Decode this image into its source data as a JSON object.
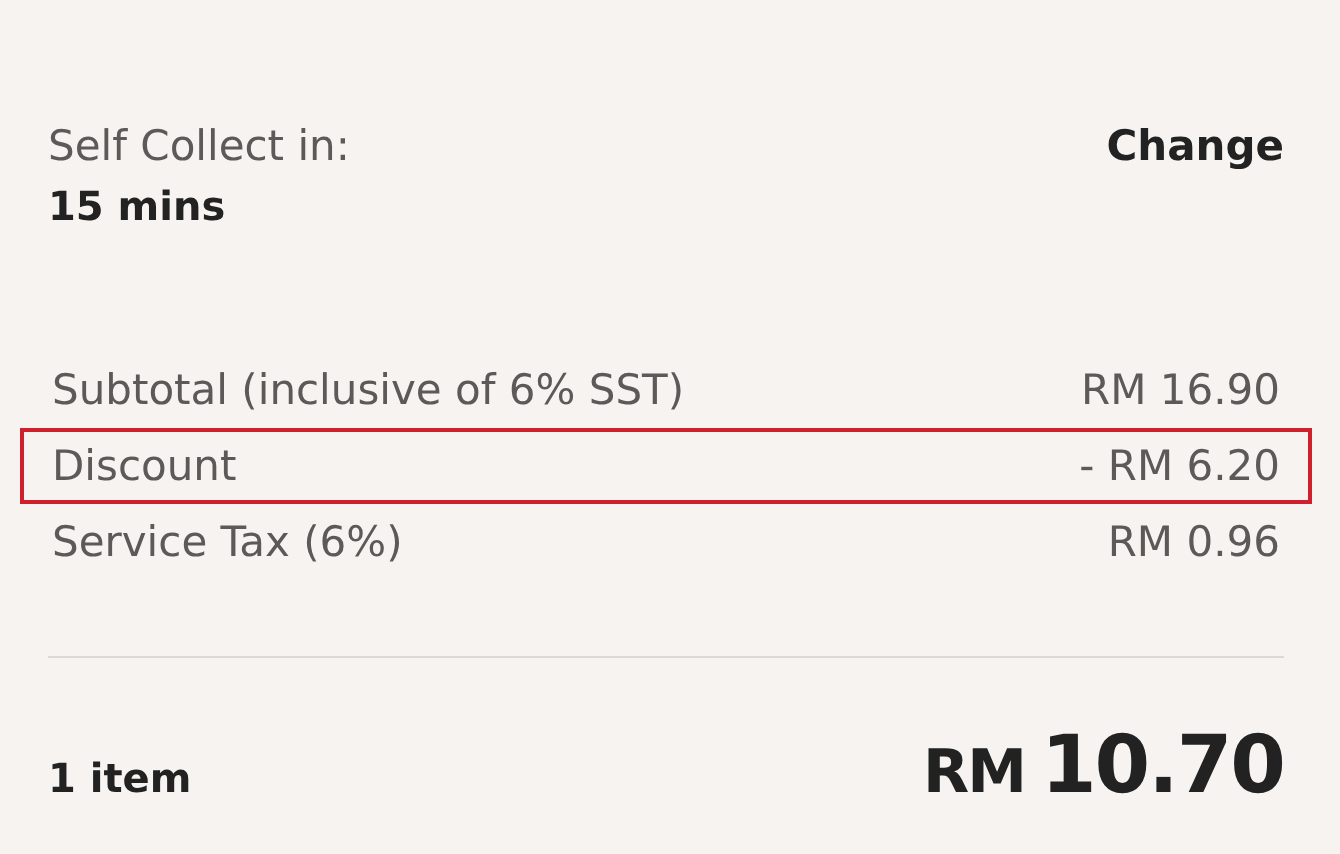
{
  "collection": {
    "label": "Self Collect in:",
    "time": "15 mins",
    "change_link": "Change"
  },
  "lines": [
    {
      "label": "Subtotal (inclusive of 6% SST)",
      "amount": "RM 16.90",
      "highlighted": false
    },
    {
      "label": "Discount",
      "amount": "- RM 6.20",
      "highlighted": true
    },
    {
      "label": "Service Tax (6%)",
      "amount": "RM 0.96",
      "highlighted": false
    }
  ],
  "total": {
    "items": "1 item",
    "currency": "RM",
    "amount": "10.70"
  }
}
